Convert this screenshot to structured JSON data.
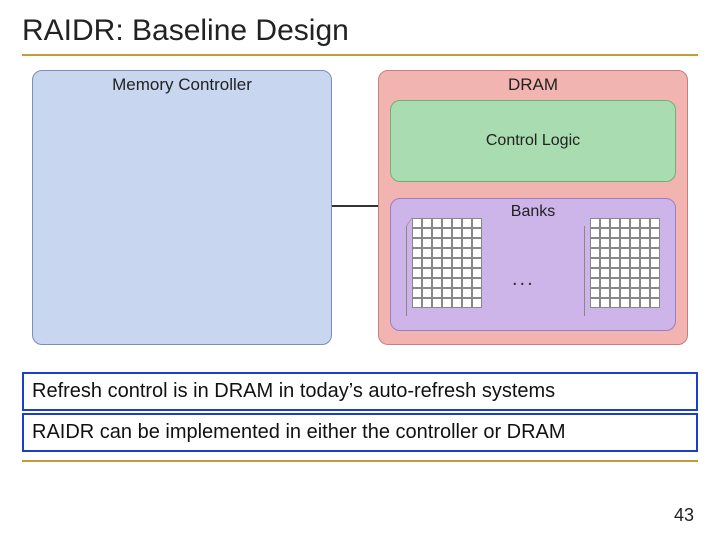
{
  "title": "RAIDR: Baseline Design",
  "diagram": {
    "memory_controller_label": "Memory Controller",
    "dram_label": "DRAM",
    "control_logic_label": "Control Logic",
    "banks_label": "Banks",
    "ellipsis": "..."
  },
  "callouts": [
    "Refresh control is in DRAM in today’s auto-refresh systems",
    "RAIDR can be implemented in either the controller or DRAM"
  ],
  "page_number": "43"
}
